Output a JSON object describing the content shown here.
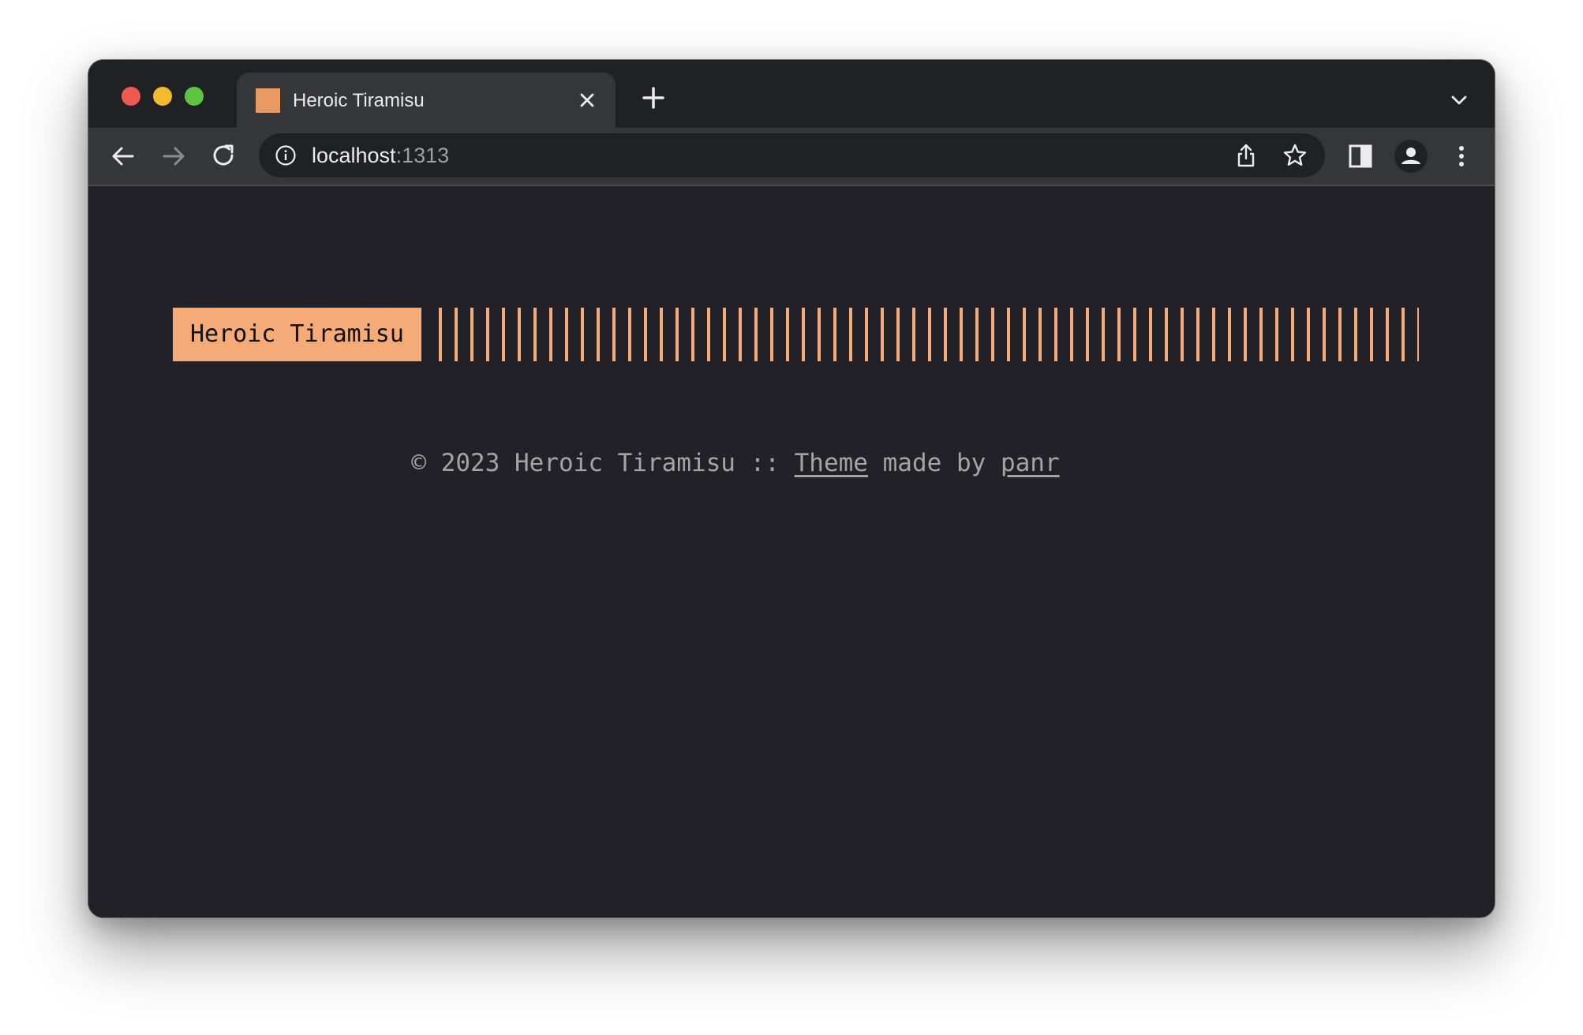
{
  "browser": {
    "tab": {
      "title": "Heroic Tiramisu",
      "favicon_color": "#e79a62",
      "close_icon": "close-icon"
    },
    "new_tab_icon": "plus-icon",
    "tab_search_icon": "chevron-down-icon",
    "toolbar": {
      "back_icon": "arrow-left-icon",
      "forward_icon": "arrow-right-icon",
      "reload_icon": "reload-icon",
      "url_host": "localhost",
      "url_port": ":1313",
      "site_info_icon": "info-icon",
      "share_icon": "share-icon",
      "bookmark_icon": "star-icon",
      "side_panel_icon": "side-panel-icon",
      "profile_icon": "profile-icon",
      "menu_icon": "more-vertical-icon"
    }
  },
  "page": {
    "logo_text": "Heroic Tiramisu",
    "accent_color": "#f4ab78",
    "background_color": "#222127",
    "footer": {
      "copyright": "© 2023 Heroic Tiramisu :: ",
      "theme_link": "Theme",
      "made_by": " made by ",
      "author_link": "panr"
    }
  }
}
